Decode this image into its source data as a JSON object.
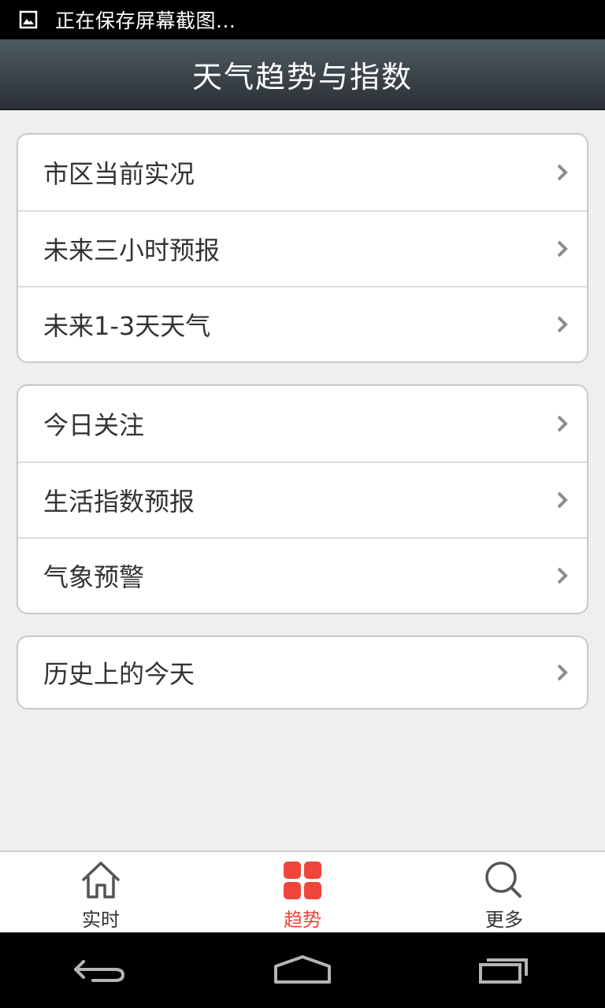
{
  "status_bar": {
    "text": "正在保存屏幕截图...",
    "icon": "gallery-icon"
  },
  "header": {
    "title": "天气趋势与指数"
  },
  "groups": [
    {
      "items": [
        {
          "label": "市区当前实况"
        },
        {
          "label": "未来三小时预报"
        },
        {
          "label": "未来1-3天天气"
        }
      ]
    },
    {
      "items": [
        {
          "label": "今日关注"
        },
        {
          "label": "生活指数预报"
        },
        {
          "label": "气象预警"
        }
      ]
    },
    {
      "items": [
        {
          "label": "历史上的今天"
        }
      ]
    }
  ],
  "tabs": [
    {
      "label": "实时",
      "icon": "home-icon",
      "active": false
    },
    {
      "label": "趋势",
      "icon": "grid-icon",
      "active": true
    },
    {
      "label": "更多",
      "icon": "search-icon",
      "active": false
    }
  ],
  "colors": {
    "accent": "#f0453a",
    "header_top": "#4d5a62",
    "header_bottom": "#2b3136",
    "background": "#efefef"
  }
}
